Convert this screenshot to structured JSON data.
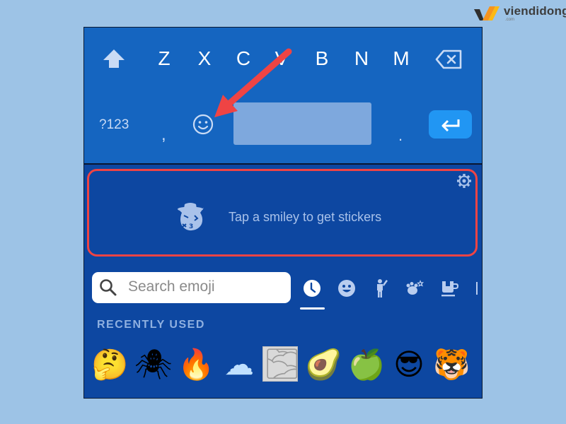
{
  "watermark": {
    "brand": "viendidong",
    "sub": ".com",
    "colors": {
      "mark_dark": "#2f2f2f",
      "mark_orange": "#f7941d",
      "mark_yellow": "#fdb913"
    }
  },
  "keyboard": {
    "row3": {
      "shift_icon": "shift-arrow-up-icon",
      "keys": [
        "Z",
        "X",
        "C",
        "V",
        "B",
        "N",
        "M"
      ],
      "backspace_icon": "backspace-icon"
    },
    "row4": {
      "symbols_label": "?123",
      "comma_label": ",",
      "emoji_icon": "smiley-face-icon",
      "spacebar_label": "",
      "period_label": ".",
      "enter_icon": "enter-return-icon"
    },
    "colors": {
      "background": "#1565c0",
      "spacebar": "#7ea8dd",
      "enter": "#2196f3"
    }
  },
  "annotation": {
    "arrow_icon": "red-pointer-arrow",
    "arrow_color": "#ef4444",
    "highlight_color": "#ef4444"
  },
  "emoji_panel": {
    "sticker_prompt": {
      "message": "Tap a smiley to get stickers",
      "illustration_icon": "cowboy-sticker-icon",
      "settings_icon": "gear-icon"
    },
    "search": {
      "placeholder": "Search emoji",
      "value": "",
      "icon": "search-icon"
    },
    "categories": [
      {
        "name": "recent",
        "icon": "clock-icon",
        "selected": true
      },
      {
        "name": "smileys",
        "icon": "smiley-icon",
        "selected": false
      },
      {
        "name": "people",
        "icon": "person-waving-icon",
        "selected": false
      },
      {
        "name": "animals",
        "icon": "bear-paw-flower-icon",
        "selected": false
      },
      {
        "name": "food",
        "icon": "coffee-cup-icon",
        "selected": false
      }
    ],
    "section_title": "RECENTLY USED",
    "recent_emojis": [
      {
        "name": "thinking-face",
        "char": "🤔"
      },
      {
        "name": "spider",
        "char": "🕷"
      },
      {
        "name": "fire",
        "char": "🔥"
      },
      {
        "name": "cloud",
        "char": "☁"
      },
      {
        "name": "fog",
        "char": "🌫"
      },
      {
        "name": "avocado",
        "char": "🥑"
      },
      {
        "name": "green-apple",
        "char": "🍏"
      },
      {
        "name": "smiling-face-with-sunglasses",
        "char": "😎"
      },
      {
        "name": "tiger-face",
        "char": "🐯"
      }
    ],
    "colors": {
      "background": "#0d47a1",
      "text_muted": "#a9c2ea",
      "section_label": "#8fb0e0"
    }
  }
}
